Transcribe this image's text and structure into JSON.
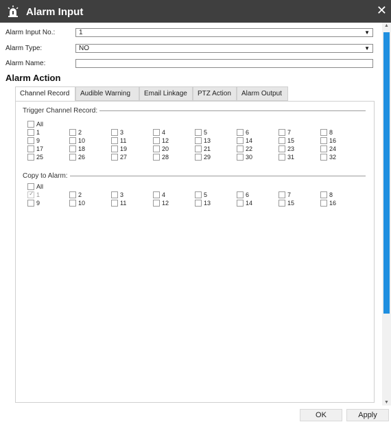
{
  "window": {
    "title": "Alarm Input",
    "close_glyph": "✕",
    "icon": "alarm-siren-icon"
  },
  "form": {
    "input_no": {
      "label": "Alarm Input No.:",
      "value": "1"
    },
    "type": {
      "label": "Alarm Type:",
      "value": "NO"
    },
    "name": {
      "label": "Alarm Name:",
      "value": ""
    }
  },
  "section_title": "Alarm Action",
  "tabs": [
    {
      "label": "Channel Record",
      "active": true
    },
    {
      "label": "Audible Warning",
      "active": false
    },
    {
      "label": "Email Linkage",
      "active": false
    },
    {
      "label": "PTZ Action",
      "active": false
    },
    {
      "label": "Alarm Output",
      "active": false
    }
  ],
  "trigger_group": {
    "title": "Trigger Channel Record:",
    "all_label": "All",
    "channels": [
      "1",
      "2",
      "3",
      "4",
      "5",
      "6",
      "7",
      "8",
      "9",
      "10",
      "11",
      "12",
      "13",
      "14",
      "15",
      "16",
      "17",
      "18",
      "19",
      "20",
      "21",
      "22",
      "23",
      "24",
      "25",
      "26",
      "27",
      "28",
      "29",
      "30",
      "31",
      "32"
    ],
    "checked": []
  },
  "copy_group": {
    "title": "Copy to Alarm:",
    "all_label": "All",
    "channels": [
      "1",
      "2",
      "3",
      "4",
      "5",
      "6",
      "7",
      "8",
      "9",
      "10",
      "11",
      "12",
      "13",
      "14",
      "15",
      "16"
    ],
    "checked": [
      "1"
    ],
    "disabled": [
      "1"
    ]
  },
  "buttons": {
    "ok": "OK",
    "apply": "Apply"
  },
  "colors": {
    "titlebar": "#3f3f3f",
    "scroll_thumb": "#1f8fe0"
  }
}
